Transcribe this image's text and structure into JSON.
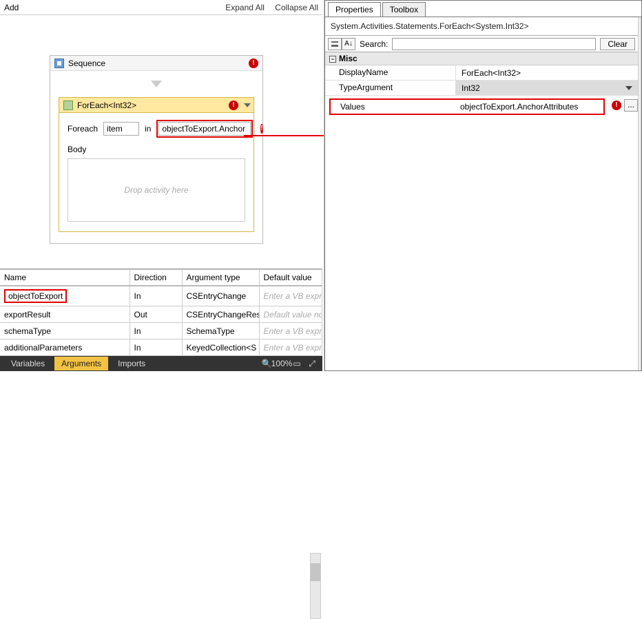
{
  "toolbar": {
    "add": "Add",
    "expand_all": "Expand All",
    "collapse_all": "Collapse All"
  },
  "sequence": {
    "title": "Sequence",
    "error_badge": "!"
  },
  "foreach": {
    "title": "ForEach<Int32>",
    "error_badge": "!",
    "label_foreach": "Foreach",
    "var_value": "item",
    "label_in": "in",
    "collection_value": "objectToExport.Anchor",
    "row_error": "!",
    "body_label": "Body",
    "drop_hint": "Drop activity here"
  },
  "grid": {
    "headers": {
      "name": "Name",
      "direction": "Direction",
      "type": "Argument type",
      "default": "Default value"
    },
    "rows": [
      {
        "name": "objectToExport",
        "direction": "In",
        "type": "CSEntryChange",
        "default": "Enter a VB express",
        "placeholder": true,
        "highlight": true
      },
      {
        "name": "exportResult",
        "direction": "Out",
        "type": "CSEntryChangeRes",
        "default": "Default value not su",
        "placeholder": true,
        "highlight": false
      },
      {
        "name": "schemaType",
        "direction": "In",
        "type": "SchemaType",
        "default": "Enter a VB express",
        "placeholder": true,
        "highlight": false
      },
      {
        "name": "additionalParameters",
        "direction": "In",
        "type": "KeyedCollection<S",
        "default": "Enter a VB express",
        "placeholder": true,
        "highlight": false
      }
    ]
  },
  "bottom": {
    "variables": "Variables",
    "arguments": "Arguments",
    "imports": "Imports",
    "zoom": "100%"
  },
  "right": {
    "tab_properties": "Properties",
    "tab_toolbox": "Toolbox",
    "type_path": "System.Activities.Statements.ForEach<System.Int32>",
    "search_label": "Search:",
    "clear_label": "Clear",
    "misc_label": "Misc",
    "props": {
      "display_name_k": "DisplayName",
      "display_name_v": "ForEach<Int32>",
      "type_arg_k": "TypeArgument",
      "type_arg_v": "Int32",
      "values_k": "Values",
      "values_v": "objectToExport.AnchorAttributes"
    },
    "values_error": "!",
    "ellipsis": "..."
  }
}
